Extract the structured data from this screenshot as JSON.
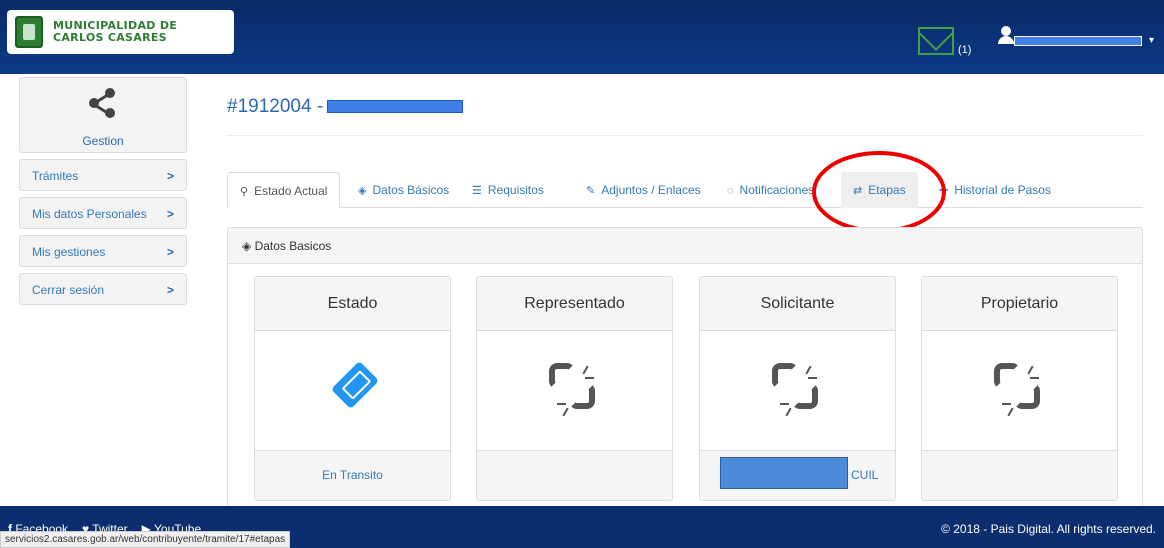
{
  "header": {
    "logo_line1": "MUNICIPALIDAD DE",
    "logo_line2": "CARLOS CASARES",
    "mail_count": "(1)"
  },
  "sidebar": {
    "gestion_label": "Gestion",
    "items": [
      {
        "label": "Trámites",
        "chevron": ">"
      },
      {
        "label": "Mis datos Personales",
        "chevron": ">"
      },
      {
        "label": "Mis gestiones",
        "chevron": ">"
      },
      {
        "label": "Cerrar sesión",
        "chevron": ">"
      }
    ]
  },
  "main": {
    "title": "#1912004 -",
    "tabs": [
      {
        "label": "Estado Actual",
        "icon": "map-marker-icon"
      },
      {
        "label": "Datos Básicos",
        "icon": "tag-icon"
      },
      {
        "label": "Requisitos",
        "icon": "list-icon"
      },
      {
        "label": "Adjuntos / Enlaces",
        "icon": "paperclip-icon"
      },
      {
        "label": "Notificaciones",
        "icon": "comment-icon"
      },
      {
        "label": "Etapas",
        "icon": "retweet-icon"
      },
      {
        "label": "Historial de Pasos",
        "icon": "expand-icon"
      }
    ],
    "panel_title": "Datos Basicos",
    "cards": [
      {
        "title": "Estado",
        "footer": "En Transito",
        "icon": "ticket-icon"
      },
      {
        "title": "Representado",
        "footer": "",
        "icon": "broken-link-icon"
      },
      {
        "title": "Solicitante",
        "footer": "CUIL",
        "icon": "broken-link-icon"
      },
      {
        "title": "Propietario",
        "footer": "",
        "icon": "broken-link-icon"
      }
    ]
  },
  "footer": {
    "facebook": "Facebook",
    "twitter": "Twitter",
    "youtube": "YouTube",
    "copyright": "© 2018 - Pais Digital. All rights reserved."
  },
  "statusbar": {
    "url": "servicios2.casares.gob.ar/web/contribuyente/tramite/17#etapas"
  },
  "colors": {
    "header_bg": "#0c3a86",
    "link": "#337ab7",
    "highlight_circle": "#e00000"
  }
}
